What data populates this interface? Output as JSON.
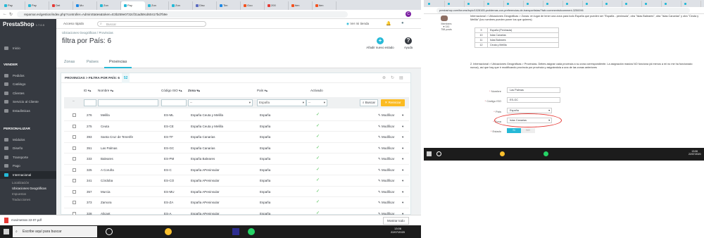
{
  "left": {
    "tabs": [
      "Pay",
      "Pay",
      "Det",
      "Mo",
      "Zon",
      "Pay",
      "Zon",
      "Zon",
      "Disc",
      "Tim",
      "Goo",
      "200",
      "tien",
      "tien"
    ],
    "url": "reparnar.es/gestion/index.php?controller=AdminStates&token=E3b259e0732cf31ad59cd60417bd7b9e",
    "logo": "PrestaShop",
    "version": "1.7.6.5",
    "quick_access": "Acceso rápido",
    "search_placeholder": "Buscar",
    "topbar_store": "Ver mi tienda",
    "sidebar": {
      "inicio": "Inicio",
      "vender": "VENDER",
      "pedidos": "Pedidos",
      "catalogo": "Catálogo",
      "clientes": "Clientes",
      "servicio": "Servicio al Cliente",
      "estadisticas": "Estadísticas",
      "personalizar": "PERSONALIZAR",
      "modulos": "Módulos",
      "diseno": "Diseño",
      "transporte": "Transporte",
      "pago": "Pago",
      "internacional": "Internacional",
      "localizacion": "Localización",
      "ubicaciones": "Ubicaciones Geográficas",
      "impuestos": "Impuestos",
      "traducciones": "Traducciones"
    },
    "breadcrumb": [
      "Ubicaciones Geográficas",
      "Provincias"
    ],
    "page_title": "filtra por País: 6",
    "toolbar": {
      "add": "Añadir nuevo estado",
      "help": "Ayuda"
    },
    "subtabs": [
      "Zonas",
      "Países",
      "Provincias"
    ],
    "panel_title": "PROVINCIAS > FILTRA POR PAÍS: 6",
    "panel_count": "52",
    "columns": {
      "id": "ID",
      "name": "Nombre",
      "iso": "Código ISO",
      "zone": "Zona",
      "country": "País",
      "active": "Activado"
    },
    "filters": {
      "zone": "--",
      "country": "España",
      "active": "--"
    },
    "buttons": {
      "search": "Buscar",
      "reset": "Reiniciar"
    },
    "edit_label": "Modificar",
    "rows": [
      {
        "id": "276",
        "name": "Melilla",
        "iso": "ES-ML",
        "zone": "España Ceuta y Melilla",
        "country": "España"
      },
      {
        "id": "275",
        "name": "Ceuta",
        "iso": "ES-CE",
        "zone": "España Ceuta y Melilla",
        "country": "España"
      },
      {
        "id": "393",
        "name": "Santa Cruz de Tenerife",
        "iso": "ES-TF",
        "zone": "España Canarias",
        "country": "España"
      },
      {
        "id": "351",
        "name": "Las Palmas",
        "iso": "ES-GC",
        "zone": "España Canarias",
        "country": "España"
      },
      {
        "id": "333",
        "name": "Baleares",
        "iso": "ES-PM",
        "zone": "España Baleares",
        "country": "España"
      },
      {
        "id": "325",
        "name": "A Coruña",
        "iso": "ES-C",
        "zone": "España APeninsular",
        "country": "España"
      },
      {
        "id": "341",
        "name": "Córdoba",
        "iso": "ES-CO",
        "zone": "España APeninsular",
        "country": "España"
      },
      {
        "id": "357",
        "name": "Murcia",
        "iso": "ES-MU",
        "zone": "España APeninsular",
        "country": "España"
      },
      {
        "id": "373",
        "name": "Zamora",
        "iso": "ES-ZA",
        "zone": "España APeninsular",
        "country": "España"
      },
      {
        "id": "328",
        "name": "Alicant",
        "iso": "ES-A",
        "zone": "España APeninsular",
        "country": "España"
      }
    ],
    "download": "movimetsss 22-07.pdf",
    "show_all": "Mostrar todo",
    "taskbar_search": "Escribe aquí para buscar",
    "time": "13:06",
    "date": "22/07/2020"
  },
  "right": {
    "url": "prestashop.com/forums/topic/1028165-problemas-con-preferencias-de-transportistas/?tab=comments#comment-3250096",
    "intro": "Internacional > Ubicaciones Geográficas > Zonas: en lugar de tener una zona para todo España que pueden ser \"España - peninsula\", otra \"Islas Baleares\", otra \"Islas Canarias\" y otra \"Ceuta y Melilla\" (los nombres pueden poner los que quieres)",
    "member_label": "Members",
    "member_count": "141",
    "member_posts": "758 posts",
    "table": [
      {
        "n": "9",
        "zone": "España (Peninsula)"
      },
      {
        "n": "10",
        "zone": "Islas Canarias"
      },
      {
        "n": "11",
        "zone": "Islas Baleares"
      },
      {
        "n": "12",
        "zone": "Ceuta y Melilla"
      }
    ],
    "para2": "2. Internacional > Ubicaciones Geográficas > Provincias. Debes asignar cada provincia a su zona correspondiente. La asignación masiva NO funciona (al menos a mi no me ha funcionado nunca), así que hay que ir modificando provincia por provincia y asignándola a una de las zonas anteriores",
    "form": {
      "name_label": "Nombre",
      "name_value": "Las Palmas",
      "iso_label": "Código ISO",
      "iso_value": "ES-GC",
      "country_label": "País",
      "country_value": "España",
      "zone_label": "Zona",
      "zone_value": "Islas Canarias",
      "status_label": "Estado",
      "yes": "Sí",
      "no": "NO"
    },
    "time": "13:06",
    "date": "22/07/2020"
  }
}
